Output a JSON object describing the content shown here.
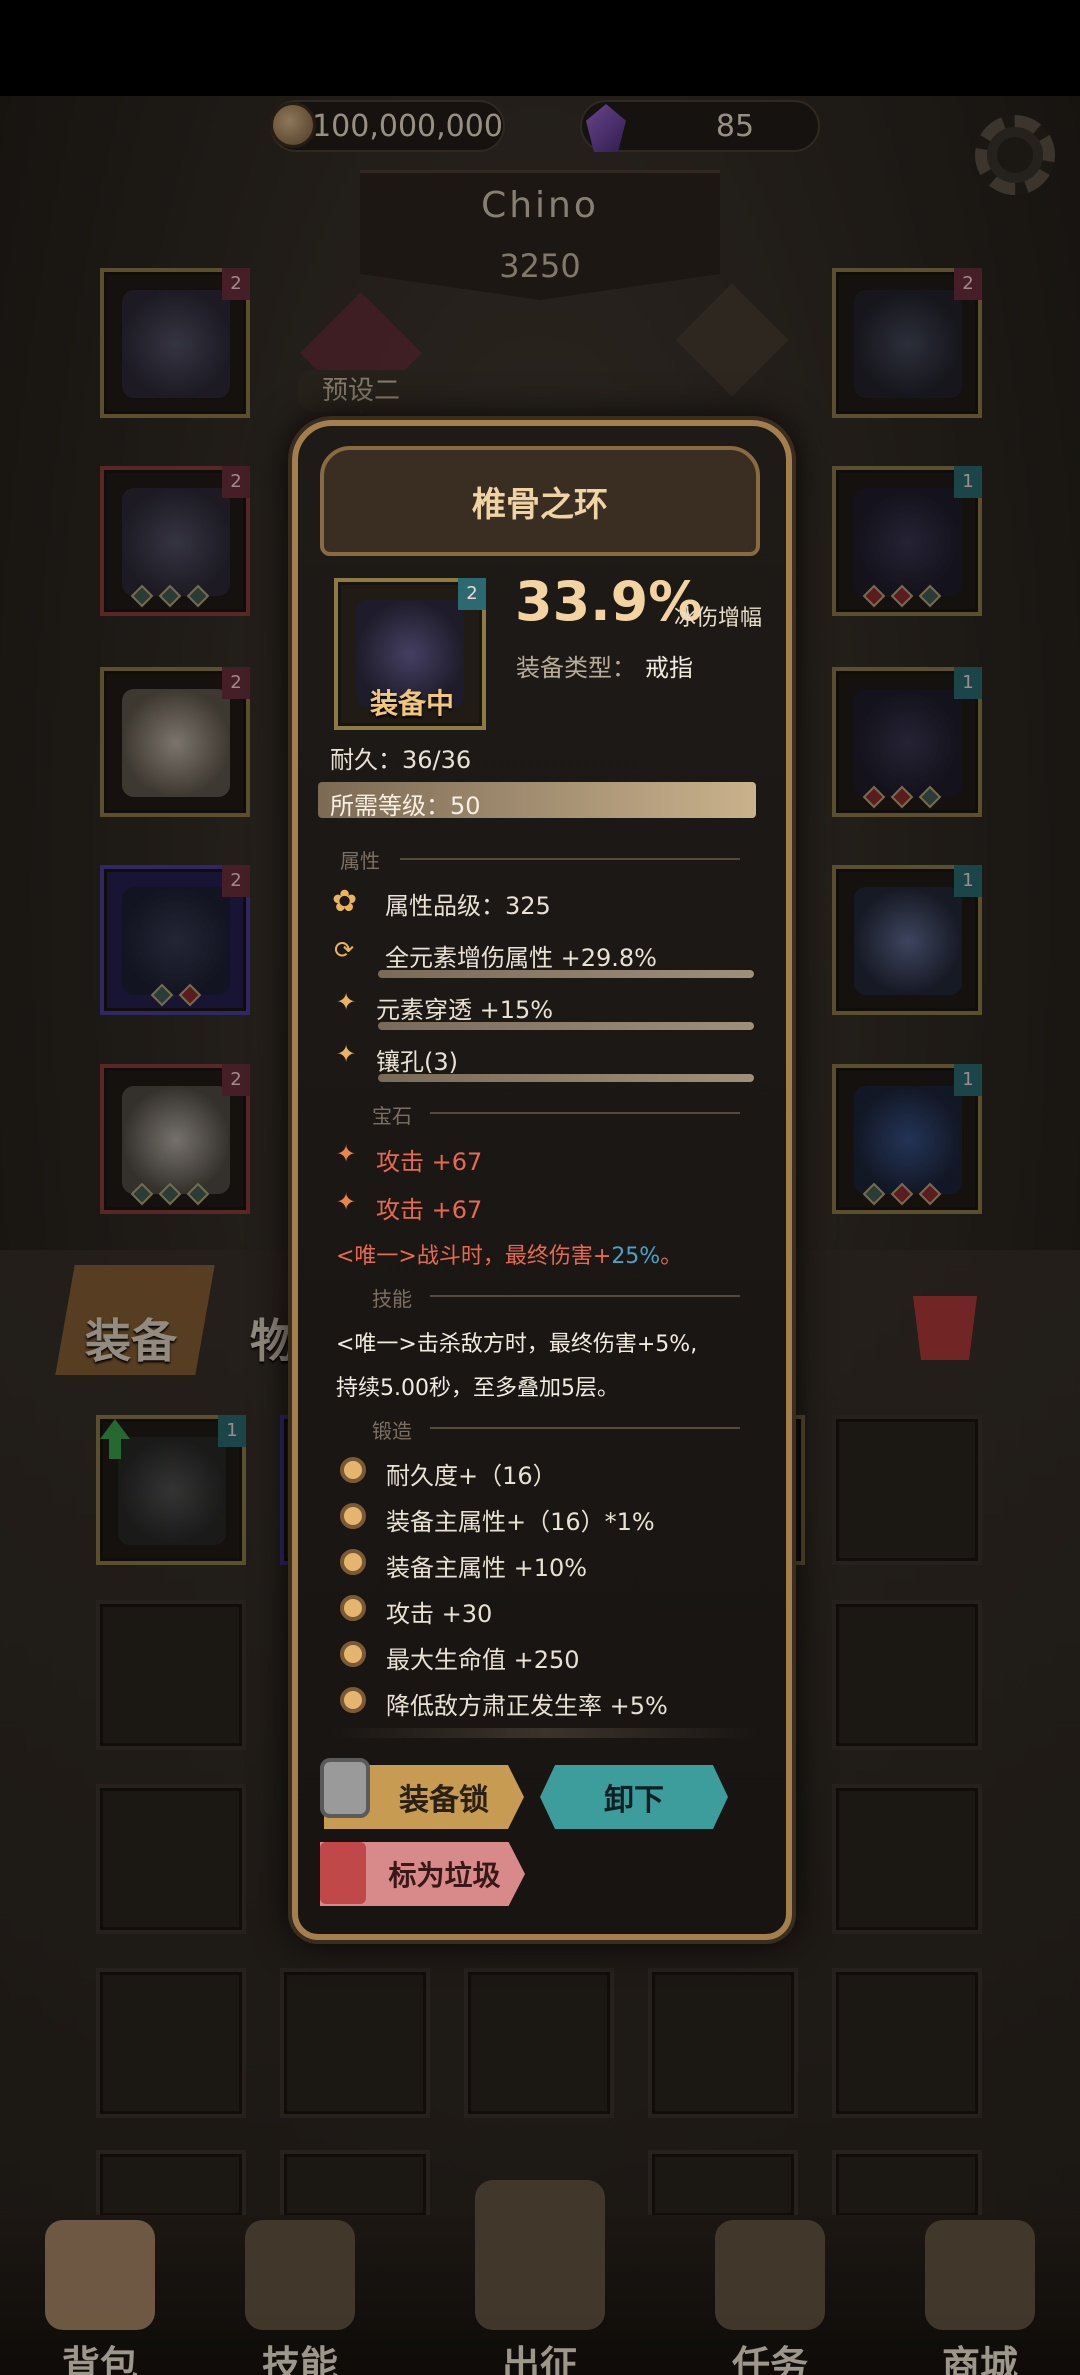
{
  "resources": {
    "coins": "100,000,000",
    "gems": "85"
  },
  "hero": {
    "name": "Chino",
    "power": "3250",
    "preset": "预设二"
  },
  "left_slot_tags": [
    "2",
    "2",
    "2",
    "2",
    "2"
  ],
  "right_slot_tags": [
    "2",
    "1",
    "1",
    "1",
    "1"
  ],
  "tabs": {
    "equip": "装备",
    "items": "物品"
  },
  "inventory": {
    "first_tag": "1"
  },
  "nav": [
    {
      "label": "背包",
      "icon": "bag-icon"
    },
    {
      "label": "技能",
      "icon": "skill-book-icon"
    },
    {
      "label": "出征",
      "icon": "sword-icon"
    },
    {
      "label": "任务",
      "icon": "scroll-icon"
    },
    {
      "label": "商城",
      "icon": "crown-icon"
    }
  ],
  "item": {
    "name": "椎骨之环",
    "tag": "2",
    "main_stat_value": "33.9%",
    "main_stat_label": "冰伤增幅",
    "type_label": "装备类型：",
    "type_value": "戒指",
    "equipped": "装备中",
    "durability": "耐久：36/36",
    "level_req": "所需等级：50",
    "sections": {
      "attributes": "属性",
      "gems": "宝石",
      "skills": "技能",
      "forging": "锻造"
    },
    "attribute_grade": "属性品级：325",
    "attributes": [
      "全元素增伤属性 +29.8%",
      "元素穿透 +15%",
      "镶孔(3)"
    ],
    "gems": [
      "攻击 +67",
      "攻击 +67"
    ],
    "unique_gem_prefix": "<唯一>战斗时，最终伤害+",
    "unique_gem_value": "25%",
    "unique_gem_suffix": "。",
    "skill_text_1": "<唯一>击杀敌方时，最终伤害+5%,",
    "skill_text_2": "持续5.00秒，至多叠加5层。",
    "forging": [
      "耐久度+（16）",
      "装备主属性+（16）*1%",
      "装备主属性 +10%",
      "攻击 +30",
      "最大生命值 +250",
      "降低敌方肃正发生率 +5%"
    ]
  },
  "buttons": {
    "lock": "装备锁",
    "unequip": "卸下",
    "trash": "标为垃圾"
  },
  "colors": {
    "accent_gold": "#e9b45d",
    "unique_red": "#e86a4e",
    "unique_blue": "#4aa3c7",
    "button_teal": "#3d9c9c"
  }
}
